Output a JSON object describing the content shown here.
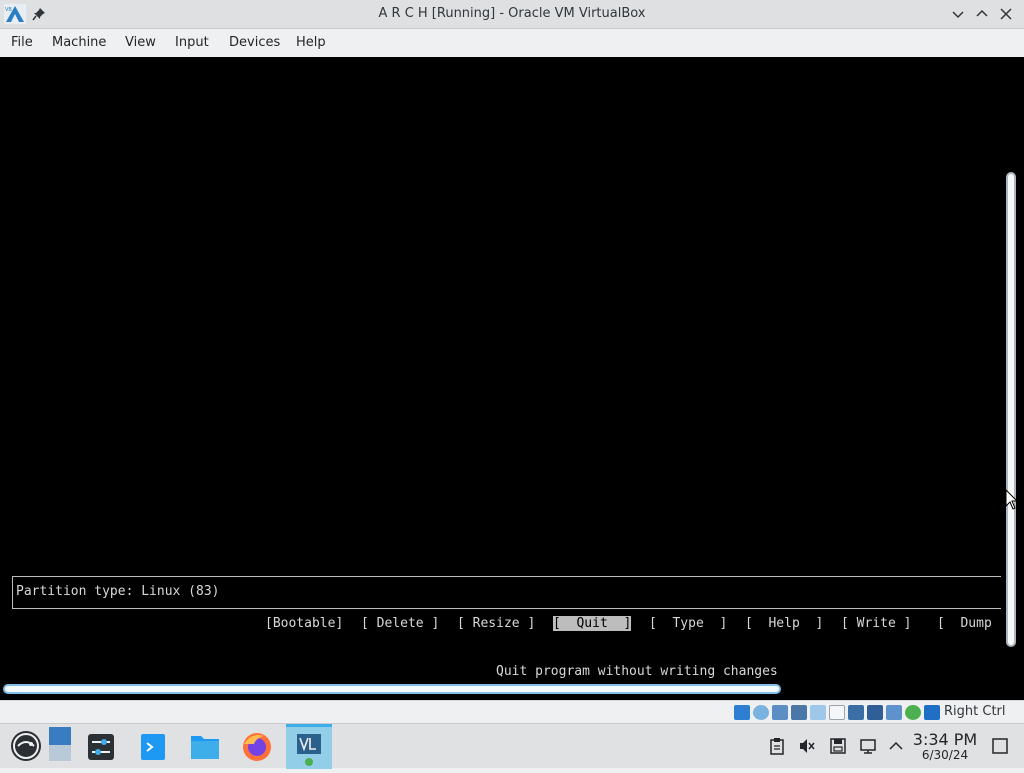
{
  "window": {
    "title": "A R C H [Running] - Oracle VM VirtualBox"
  },
  "menu": {
    "items": [
      "File",
      "Machine",
      "View",
      "Input",
      "Devices",
      "Help"
    ]
  },
  "terminal": {
    "partition_type": "Partition type: Linux (83)",
    "buttons": [
      "[Bootable]",
      "[ Delete ]",
      "[ Resize ]",
      "[  Quit  ]",
      "[  Type  ]",
      "[  Help  ]",
      "[ Write ]",
      "[  Dump"
    ],
    "selected_button": "[  Quit  ]",
    "help_text": "Quit program without writing changes"
  },
  "statusbar": {
    "host_key": "Right Ctrl",
    "icons": [
      "hard-disk-icon",
      "optical-drive-icon",
      "audio-icon",
      "network-icon",
      "usb-icon",
      "shared-folder-icon",
      "display-icon",
      "recording-icon",
      "vt-x-icon",
      "guest-additions-icon",
      "mouse-integration-icon"
    ]
  },
  "taskbar": {
    "apps": [
      "application-launcher",
      "virtualbox-manager",
      "settings",
      "discover",
      "file-manager",
      "firefox",
      "virtualbox"
    ],
    "clock_time": "3:34 PM",
    "clock_date": "6/30/24"
  },
  "colors": {
    "accent": "#3daee9",
    "terminal_bg": "#000000",
    "terminal_fg": "#d8d8d8"
  }
}
